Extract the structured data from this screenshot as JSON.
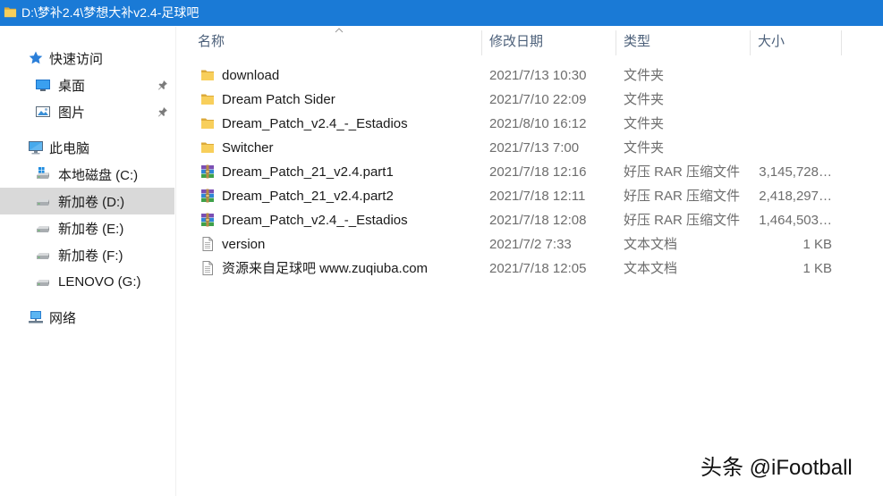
{
  "theme": {
    "titlebar_bg": "#1a7ad6",
    "selected_bg": "#d9d9d9",
    "header_text": "#4c607a",
    "secondary_text": "#6d6d6d"
  },
  "window": {
    "title": "D:\\梦补2.4\\梦想大补v2.4-足球吧",
    "icon": "folder-icon"
  },
  "nav": {
    "quick_access": {
      "label": "快速访问",
      "icon": "star-icon"
    },
    "quick_items": [
      {
        "label": "桌面",
        "icon": "desktop-icon",
        "pinned": true
      },
      {
        "label": "图片",
        "icon": "pictures-icon",
        "pinned": true
      }
    ],
    "this_pc": {
      "label": "此电脑",
      "icon": "computer-icon"
    },
    "drives": [
      {
        "label": "本地磁盘 (C:)",
        "icon": "system-drive-icon",
        "selected": false
      },
      {
        "label": "新加卷 (D:)",
        "icon": "drive-icon",
        "selected": true
      },
      {
        "label": "新加卷 (E:)",
        "icon": "drive-icon",
        "selected": false
      },
      {
        "label": "新加卷 (F:)",
        "icon": "drive-icon",
        "selected": false
      },
      {
        "label": "LENOVO (G:)",
        "icon": "drive-icon",
        "selected": false
      }
    ],
    "network": {
      "label": "网络",
      "icon": "network-icon"
    }
  },
  "columns": {
    "name": "名称",
    "modified": "修改日期",
    "type": "类型",
    "size": "大小",
    "sort_icon": "chevron-up-icon"
  },
  "files": [
    {
      "name": "download",
      "modified": "2021/7/13 10:30",
      "type": "文件夹",
      "icon": "folder-icon"
    },
    {
      "name": "Dream Patch Sider",
      "modified": "2021/7/10 22:09",
      "type": "文件夹",
      "icon": "folder-icon"
    },
    {
      "name": "Dream_Patch_v2.4_-_Estadios",
      "modified": "2021/8/10 16:12",
      "type": "文件夹",
      "icon": "folder-icon"
    },
    {
      "name": "Switcher",
      "modified": "2021/7/13 7:00",
      "type": "文件夹",
      "icon": "folder-icon"
    },
    {
      "name": "Dream_Patch_21_v2.4.part1",
      "modified": "2021/7/18 12:16",
      "type": "好压 RAR 压缩文件",
      "size": "3,145,728…",
      "icon": "rar-archive-icon"
    },
    {
      "name": "Dream_Patch_21_v2.4.part2",
      "modified": "2021/7/18 12:11",
      "type": "好压 RAR 压缩文件",
      "size": "2,418,297…",
      "icon": "rar-archive-icon"
    },
    {
      "name": "Dream_Patch_v2.4_-_Estadios",
      "modified": "2021/7/18 12:08",
      "type": "好压 RAR 压缩文件",
      "size": "1,464,503…",
      "icon": "rar-archive-icon"
    },
    {
      "name": "version",
      "modified": "2021/7/2 7:33",
      "type": "文本文档",
      "size": "1 KB",
      "icon": "text-document-icon"
    },
    {
      "name": "资源来自足球吧 www.zuqiuba.com",
      "modified": "2021/7/18 12:05",
      "type": "文本文档",
      "size": "1 KB",
      "icon": "text-document-icon"
    }
  ],
  "watermark": "头条 @iFootball"
}
